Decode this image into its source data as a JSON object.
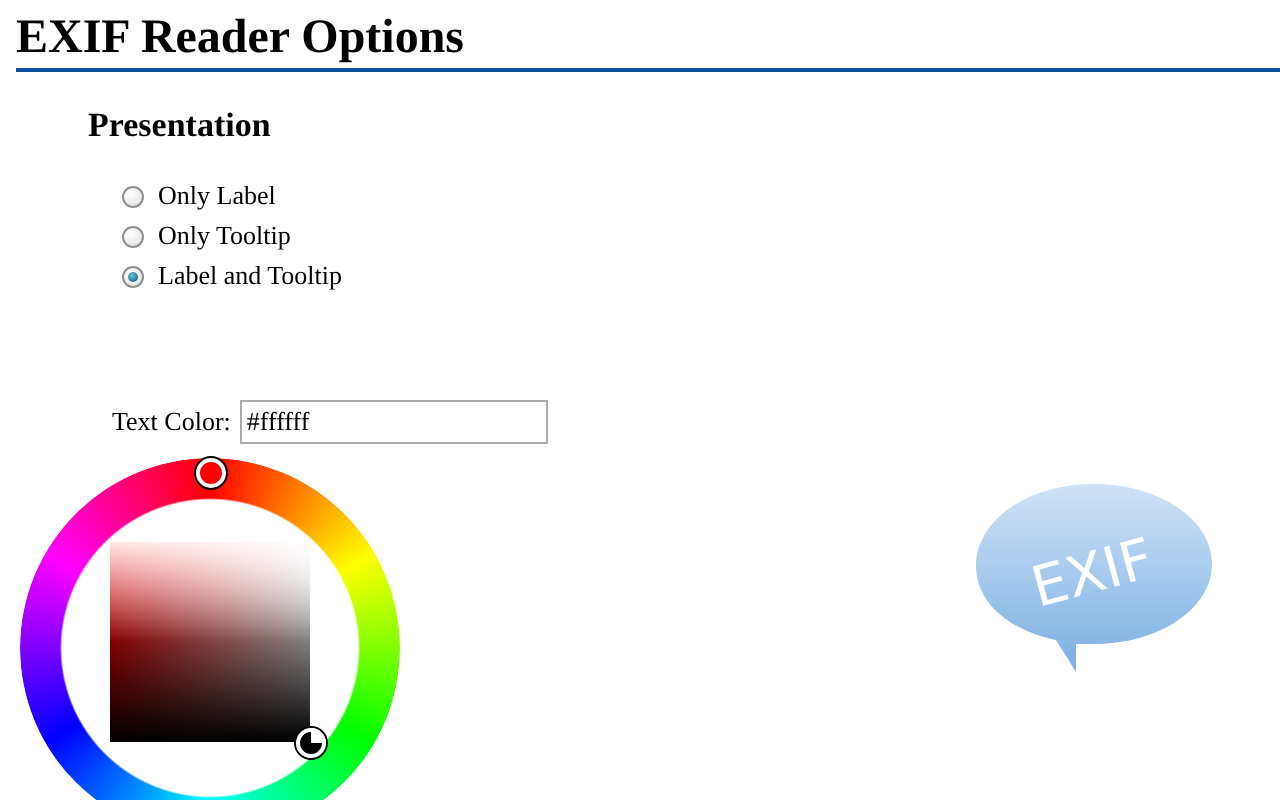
{
  "page": {
    "title": "EXIF Reader Options"
  },
  "presentation": {
    "heading": "Presentation",
    "options": [
      {
        "label": "Only Label",
        "selected": false
      },
      {
        "label": "Only Tooltip",
        "selected": false
      },
      {
        "label": "Label and Tooltip",
        "selected": true
      }
    ]
  },
  "text_color": {
    "label": "Text Color:",
    "value": "#ffffff"
  },
  "logo": {
    "text": "EXIF"
  }
}
